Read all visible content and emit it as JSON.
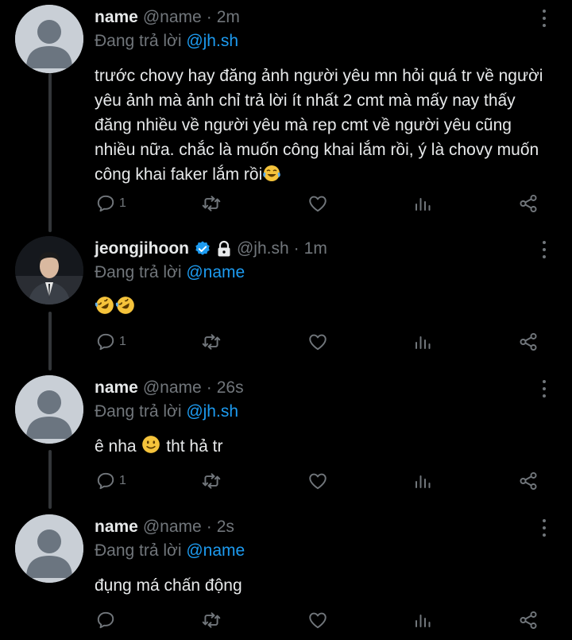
{
  "tweets": [
    {
      "name": "name",
      "handle": "@name",
      "time": "2m",
      "reply_prefix": "Đang trả lời",
      "reply_mention": "@jh.sh",
      "text": "trước chovy hay đăng ảnh người yêu mn hỏi quá tr về người yêu ảnh mà ảnh chỉ trả lời ít nhất 2 cmt mà mấy nay thấy đăng nhiều về người yêu mà rep cmt về người yêu cũng nhiều nữa. chắc là muốn công khai lắm rồi, ý là chovy muốn công khai faker lắm rồi",
      "emoji": "face-with-tears-of-joy",
      "reply_count": "1"
    },
    {
      "name": "jeongjihoon",
      "handle": "@jh.sh",
      "time": "1m",
      "verified": true,
      "protected": true,
      "reply_prefix": "Đang trả lời",
      "reply_mention": "@name",
      "text": "",
      "emoji": "rolling-on-floor-laughing x2",
      "reply_count": "1"
    },
    {
      "name": "name",
      "handle": "@name",
      "time": "26s",
      "reply_prefix": "Đang trả lời",
      "reply_mention": "@jh.sh",
      "text_before": "ê nha",
      "emoji": "slightly-smiling-face",
      "text_after": "tht hả tr",
      "reply_count": "1"
    },
    {
      "name": "name",
      "handle": "@name",
      "time": "2s",
      "reply_prefix": "Đang trả lời",
      "reply_mention": "@name",
      "text": "đụng má chấn động",
      "reply_count": ""
    }
  ],
  "icons": [
    "reply-icon",
    "retweet-icon",
    "like-icon",
    "views-icon",
    "share-icon",
    "more-icon",
    "verified-badge-icon",
    "lock-icon"
  ],
  "colors": {
    "background": "#000000",
    "text": "#e7e9ea",
    "muted": "#71767b",
    "accent": "#1d9bf0",
    "thread_line": "#333639"
  }
}
